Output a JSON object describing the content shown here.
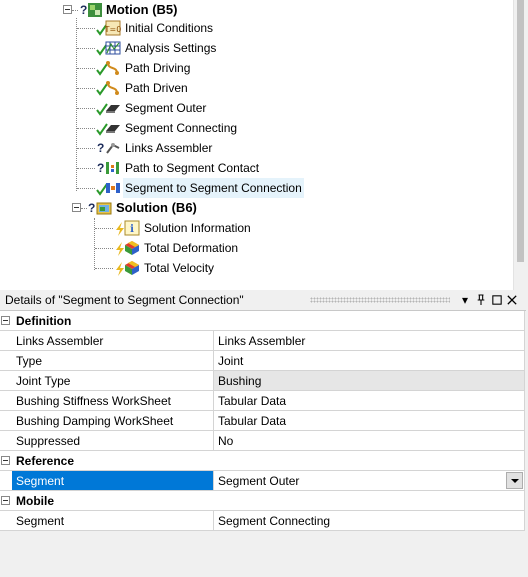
{
  "tree": {
    "items": [
      {
        "id": "motion",
        "label": "Motion (B5)",
        "bold": true,
        "status": "question",
        "icon": "motion-icon"
      },
      {
        "id": "initial",
        "label": "Initial Conditions",
        "status": "check",
        "icon": "initial-conditions-icon"
      },
      {
        "id": "analysis",
        "label": "Analysis Settings",
        "status": "check",
        "icon": "analysis-settings-icon"
      },
      {
        "id": "pathdriving",
        "label": "Path Driving",
        "status": "check",
        "icon": "path-driving-icon"
      },
      {
        "id": "pathdriven",
        "label": "Path Driven",
        "status": "check",
        "icon": "path-driven-icon"
      },
      {
        "id": "segouter",
        "label": "Segment Outer",
        "status": "check",
        "icon": "segment-icon"
      },
      {
        "id": "segconn",
        "label": "Segment Connecting",
        "status": "check",
        "icon": "segment-icon"
      },
      {
        "id": "links",
        "label": "Links Assembler",
        "status": "question",
        "icon": "links-assembler-icon"
      },
      {
        "id": "pathcontact",
        "label": "Path to Segment Contact",
        "status": "question",
        "icon": "contact-icon"
      },
      {
        "id": "segsegconn",
        "label": "Segment to Segment Connection",
        "status": "check",
        "icon": "connection-icon",
        "selected": true
      },
      {
        "id": "solution",
        "label": "Solution (B6)",
        "bold": true,
        "status": "question",
        "icon": "solution-icon"
      },
      {
        "id": "solinfo",
        "label": "Solution Information",
        "status": "lightning",
        "icon": "solution-information-icon"
      },
      {
        "id": "totdef",
        "label": "Total Deformation",
        "status": "lightning",
        "icon": "total-deformation-icon"
      },
      {
        "id": "totvel",
        "label": "Total Velocity",
        "status": "lightning",
        "icon": "total-velocity-icon"
      }
    ]
  },
  "details": {
    "title": "Details of \"Segment to Segment Connection\"",
    "buttons": {
      "dropdown": "▾",
      "pin": "📌",
      "maximize": "□",
      "close": "×"
    },
    "categories": [
      {
        "name": "Definition",
        "rows": [
          {
            "key": "Links Assembler",
            "value": "Links Assembler"
          },
          {
            "key": "Type",
            "value": "Joint"
          },
          {
            "key": "Joint Type",
            "value": "Bushing",
            "shaded": true
          },
          {
            "key": "Bushing Stiffness WorkSheet",
            "value": "Tabular Data"
          },
          {
            "key": "Bushing Damping WorkSheet",
            "value": "Tabular Data"
          },
          {
            "key": "Suppressed",
            "value": "No"
          }
        ]
      },
      {
        "name": "Reference",
        "rows": [
          {
            "key": "Segment",
            "value": "Segment Outer",
            "selected": true,
            "dropdown": true
          }
        ]
      },
      {
        "name": "Mobile",
        "rows": [
          {
            "key": "Segment",
            "value": "Segment Connecting"
          }
        ]
      }
    ]
  }
}
